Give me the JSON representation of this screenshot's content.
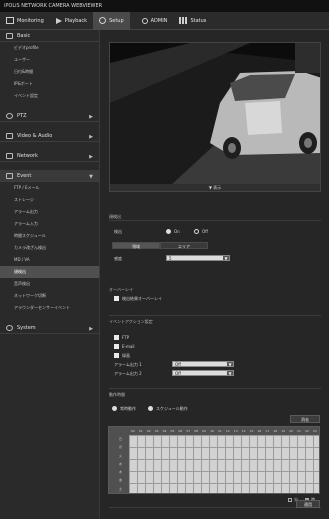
{
  "app": {
    "title": "iPOLiS NETWORK CAMERA WEBVIEWER"
  },
  "nav": {
    "tabs": [
      {
        "label": "Monitoring"
      },
      {
        "label": "Playback"
      },
      {
        "label": "Setup"
      },
      {
        "label": "ADMIN"
      },
      {
        "label": "Status"
      }
    ]
  },
  "sidebar": {
    "basic": "Basic",
    "basic_items": [
      "ビデオprofile",
      "ユーザー",
      "日付&時間",
      "IP&ポート",
      "イベント設定"
    ],
    "ptz": "PTZ",
    "video_audio": "Video & Audio",
    "network": "Network",
    "event": "Event",
    "event_items": [
      "FTP / Eメール",
      "ストレージ",
      "アラーム出力",
      "アラーム入力",
      "時間スケジュール",
      "カメラ改ざん検出",
      "MD / VA",
      "顔検出",
      "音声検出",
      "ネットワーク切断",
      "アラウンダーセンサーイベント"
    ],
    "system": "System"
  },
  "main": {
    "video_bar": "▼ 表示",
    "section_detect": "顔検出",
    "enable_label": "検出",
    "on_label": "On",
    "off_label": "Off",
    "subtabs": [
      "領域",
      "エリア"
    ],
    "sensitivity_label": "感度",
    "sensitivity_value": "5",
    "overlay_title": "オーバーレイ",
    "overlay_check_label": "検出結果オーバーレイ",
    "action_section": "イベントアクション設定",
    "actions": [
      "FTP",
      "E-mail",
      "録画"
    ],
    "alarm1_label": "アラーム出力 1",
    "alarm1_value": "Off",
    "alarm2_label": "アラーム出力 2",
    "alarm2_value": "Off",
    "time_section": "動作時間",
    "always_label": "常時動作",
    "schedule_label": "スケジュール動作",
    "clear_button": "消去",
    "hours": [
      "00",
      "01",
      "02",
      "03",
      "04",
      "05",
      "06",
      "07",
      "08",
      "09",
      "10",
      "11",
      "12",
      "13",
      "14",
      "15",
      "16",
      "17",
      "18",
      "19",
      "20",
      "21",
      "22",
      "23"
    ],
    "days": [
      "日",
      "月",
      "火",
      "水",
      "木",
      "金",
      "土"
    ],
    "legend_a": "分",
    "legend_b": "時",
    "apply_button": "適用"
  }
}
